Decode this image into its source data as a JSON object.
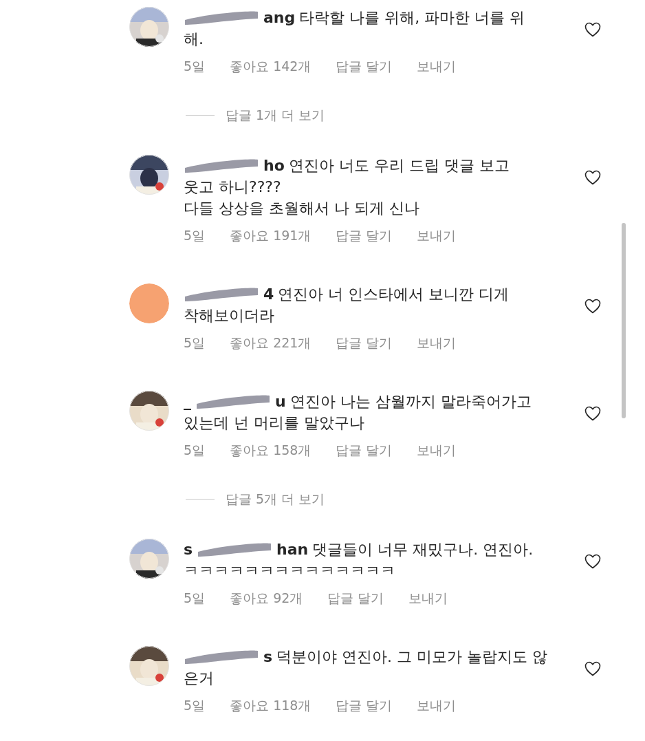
{
  "items": [
    {
      "kind": "comment",
      "user_tail": "ang",
      "text": "타락할 나를 위해, 파마한 너를 위",
      "text_more": "해.",
      "time": "5일",
      "likes": "좋아요 142개",
      "reply": "답글 달기",
      "send": "보내기",
      "liked": false
    },
    {
      "kind": "more_replies",
      "label": "답글 1개 더 보기"
    },
    {
      "kind": "comment",
      "user_tail": "ho",
      "text": "연진아 너도 우리 드립 댓글 보고",
      "text_more": "웃고 하니????\n다들 상상을 초월해서 나 되게 신나",
      "time": "5일",
      "likes": "좋아요 191개",
      "reply": "답글 달기",
      "send": "보내기",
      "liked": false
    },
    {
      "kind": "comment",
      "avatar": {
        "kind": "plain",
        "color": "#f6a271"
      },
      "user_tail": "4",
      "text": "연진아 너 인스타에서 보니깐 디게",
      "text_more": "착해보이더라",
      "time": "5일",
      "likes": "좋아요 221개",
      "reply": "답글 달기",
      "send": "보내기",
      "liked": false
    },
    {
      "kind": "comment",
      "user_head": "_",
      "user_tail": "u",
      "text": "연진아 나는 삼월까지 말라죽어가고",
      "text_more": "있는데 넌 머리를 말았구나",
      "time": "5일",
      "likes": "좋아요 158개",
      "reply": "답글 달기",
      "send": "보내기",
      "liked": false
    },
    {
      "kind": "more_replies",
      "label": "답글 5개 더 보기"
    },
    {
      "kind": "comment",
      "user_head": "s",
      "user_tail": "han",
      "text": "댓글들이 너무 재밌구나. 연진아.",
      "text_more": "ㅋㅋㅋㅋㅋㅋㅋㅋㅋㅋㅋㅋㅋㅋ",
      "time": "5일",
      "likes": "좋아요 92개",
      "reply": "답글 달기",
      "send": "보내기",
      "liked": false
    },
    {
      "kind": "comment",
      "user_tail": "s",
      "text": "덕분이야 연진아. 그 미모가 놀랍지도 않",
      "text_more": "은거",
      "time": "5일",
      "likes": "좋아요 118개",
      "reply": "답글 달기",
      "send": "보내기",
      "liked": false
    }
  ]
}
